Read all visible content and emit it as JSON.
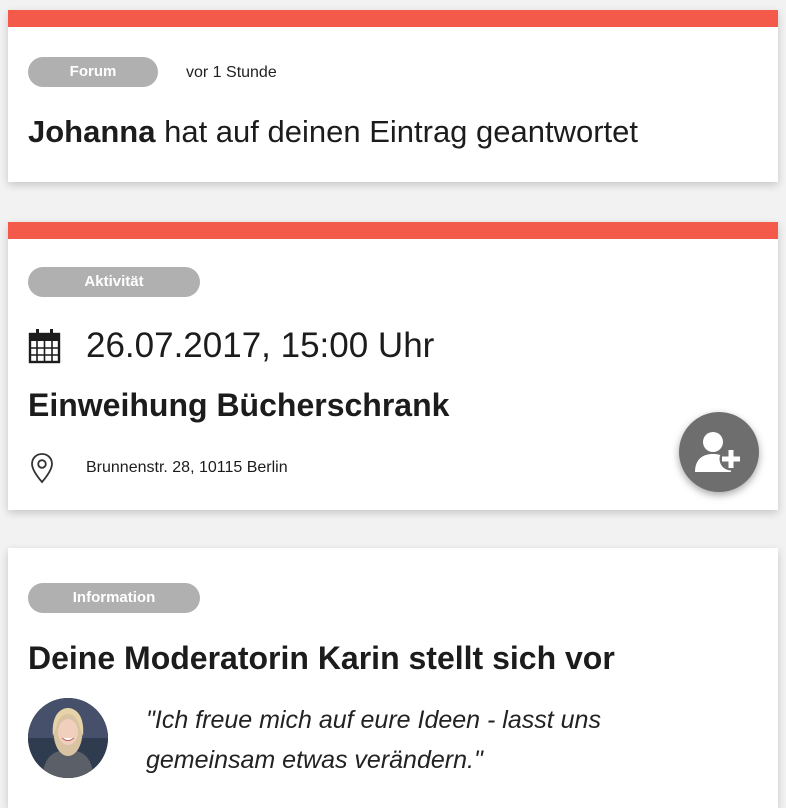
{
  "forum_card": {
    "badge": "Forum",
    "time": "vor 1 Stunde",
    "author": "Johanna",
    "message": " hat auf deinen Eintrag geantwortet"
  },
  "activity_card": {
    "badge": "Aktivität",
    "date": "26.07.2017, 15:00 Uhr",
    "title": "Einweihung Bücherschrank",
    "address": "Brunnenstr. 28, 10115 Berlin",
    "icons": {
      "date": "calendar-icon",
      "location": "location-pin-icon",
      "join": "add-user-icon"
    }
  },
  "info_card": {
    "badge": "Information",
    "title": "Deine Moderatorin Karin stellt sich vor",
    "quote": "\"Ich freue mich auf eure Ideen - lasst uns gemeinsam etwas verändern.\""
  },
  "colors": {
    "accent": "#f35a4a",
    "badge": "#b0b0b0",
    "fab": "#6e6e6e",
    "background": "#f2f2f2"
  }
}
